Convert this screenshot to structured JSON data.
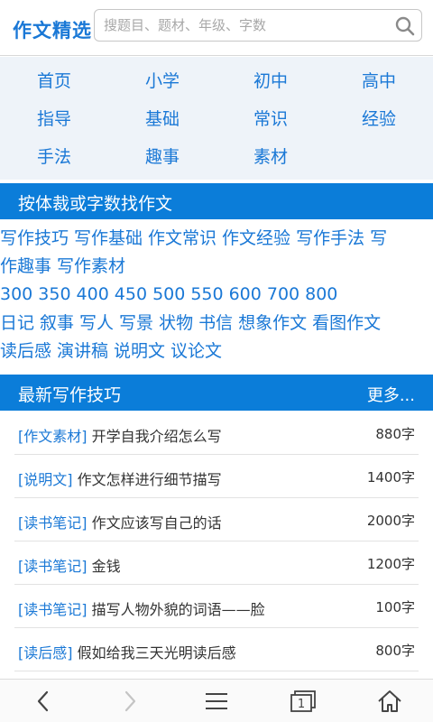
{
  "header": {
    "logo": "作文精选",
    "search_placeholder": "搜题目、题材、年级、字数"
  },
  "nav": {
    "items": [
      "首页",
      "小学",
      "初中",
      "高中",
      "指导",
      "基础",
      "常识",
      "经验",
      "手法",
      "趣事",
      "素材"
    ]
  },
  "section_find": {
    "title": "按体裁或字数找作文"
  },
  "categories": {
    "line1": [
      "写作技巧",
      "写作基础",
      "作文常识",
      "作文经验",
      "写作手法",
      "写"
    ],
    "line2": [
      "作趣事",
      "写作素材"
    ],
    "line3": [
      "300",
      "350",
      "400",
      "450",
      "500",
      "550",
      "600",
      "700",
      "800"
    ],
    "line4": [
      "日记",
      "叙事",
      "写人",
      "写景",
      "状物",
      "书信",
      "想象作文",
      "看图作文"
    ],
    "line5": [
      "读后感",
      "演讲稿",
      "说明文",
      "议论文"
    ]
  },
  "section_latest": {
    "title": "最新写作技巧",
    "more": "更多..."
  },
  "articles": [
    {
      "tag": "[作文素材]",
      "title": "开学自我介绍怎么写",
      "count": "880字"
    },
    {
      "tag": "[说明文]",
      "title": "作文怎样进行细节描写",
      "count": "1400字"
    },
    {
      "tag": "[读书笔记]",
      "title": "作文应该写自己的话",
      "count": "2000字"
    },
    {
      "tag": "[读书笔记]",
      "title": "金钱",
      "count": "1200字"
    },
    {
      "tag": "[读书笔记]",
      "title": "描写人物外貌的词语——脸",
      "count": "100字"
    },
    {
      "tag": "[读后感]",
      "title": "假如给我三天光明读后感",
      "count": "800字"
    }
  ],
  "toolbar": {
    "icons": [
      "back-icon",
      "forward-icon",
      "menu-icon",
      "tabs-icon",
      "home-icon"
    ],
    "tab_count": "1"
  },
  "colors": {
    "accent": "#1a78d6",
    "section_bar": "#0b7dd9",
    "nav_bg": "#eef3f9"
  }
}
